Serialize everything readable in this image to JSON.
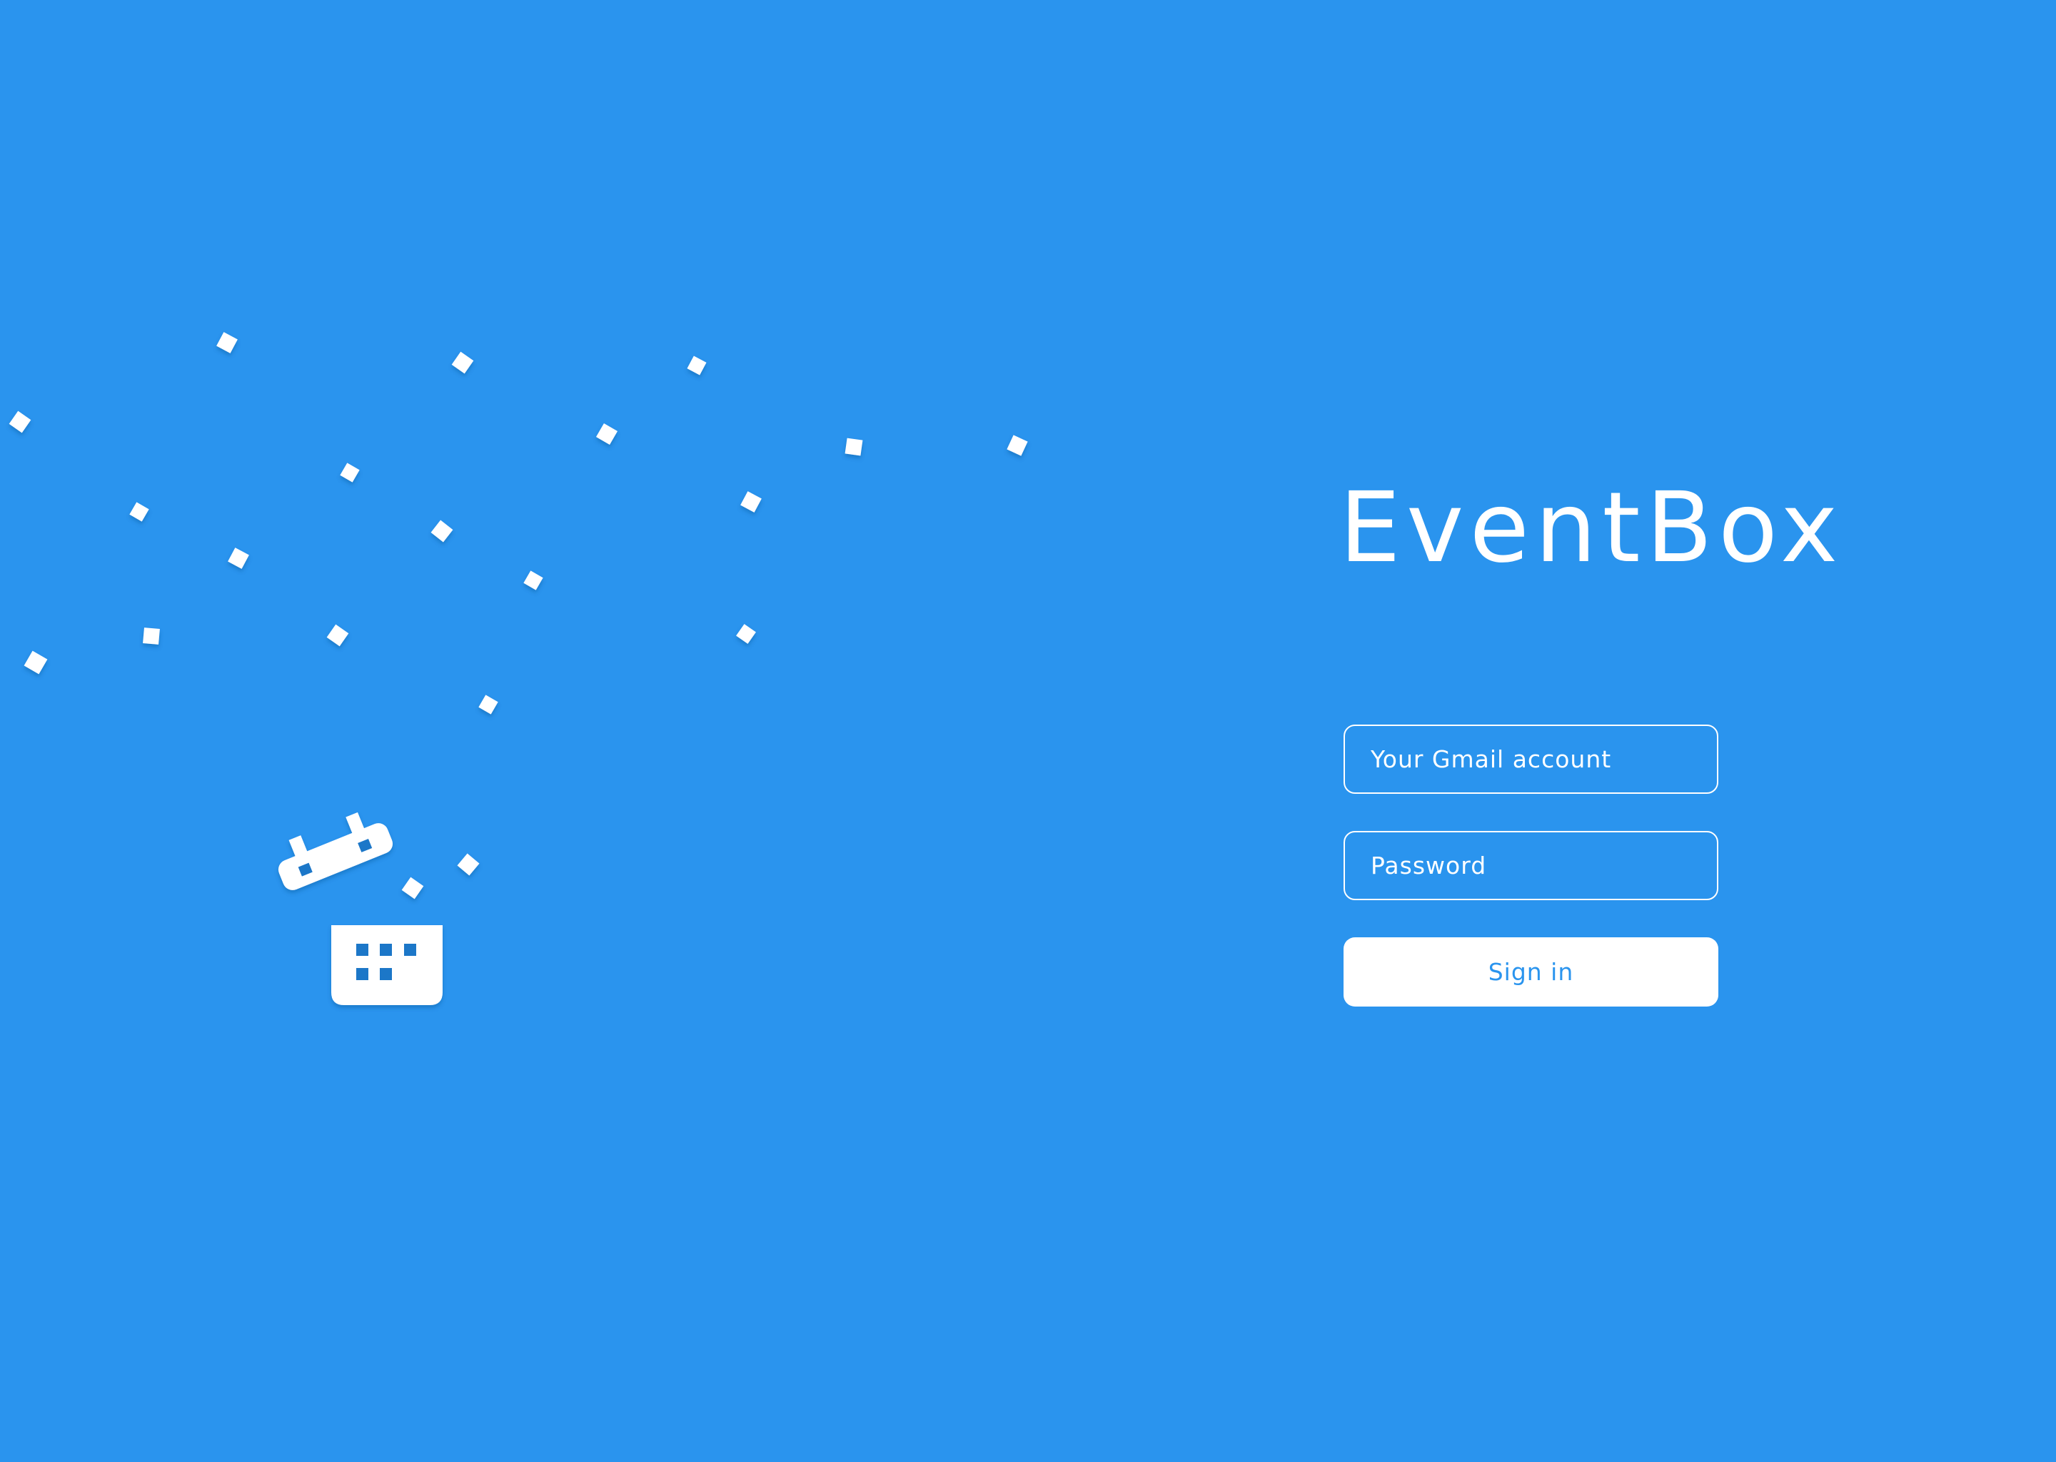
{
  "app": {
    "title": "EventBox"
  },
  "form": {
    "email_placeholder": "Your Gmail account",
    "password_placeholder": "Password",
    "signin_label": "Sign in"
  },
  "colors": {
    "background": "#2A94EE",
    "foreground": "#FFFFFF",
    "accent_text": "#2A94EE",
    "icon_detail": "#1F77C8"
  },
  "icons": {
    "illustration": "calendar-confetti-icon"
  }
}
